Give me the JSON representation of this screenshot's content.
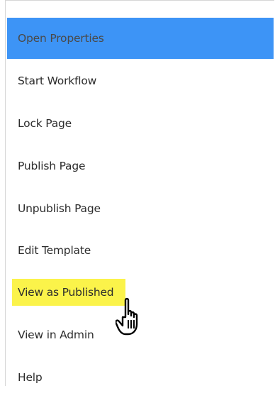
{
  "menu": {
    "items": [
      {
        "label": "Open Properties",
        "state": "selected"
      },
      {
        "label": "Start Workflow"
      },
      {
        "label": "Lock Page"
      },
      {
        "label": "Publish Page"
      },
      {
        "label": "Unpublish Page"
      },
      {
        "label": "Edit Template"
      },
      {
        "label": "View as Published",
        "state": "highlighted"
      },
      {
        "label": "View in Admin"
      },
      {
        "label": "Help"
      }
    ]
  },
  "colors": {
    "selected_bg": "#3d94f6",
    "highlight_bg": "#fbf34a",
    "text": "#2c2c2c"
  },
  "cursor": {
    "icon": "hand-pointer-icon"
  }
}
